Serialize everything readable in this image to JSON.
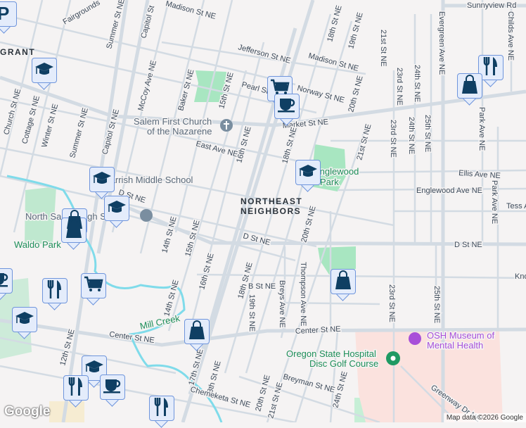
{
  "map": {
    "attribution": "Map data ©2026 Google",
    "logo": "Google",
    "colors": {
      "background": "#f5f3f3",
      "road": "#d3dbe3",
      "park": "#a8e6c1",
      "hospital": "#fbe2de",
      "creek": "#7fdbea",
      "marker_fill": "#e4ecfb",
      "marker_border": "#6f95dc",
      "icon": "#0f3f63"
    },
    "neighborhoods": [
      "GRANT",
      "NORTHEAST",
      "NEIGHBORS"
    ],
    "streets": [
      "Madison St NE",
      "Fairgrounds",
      "Summer St NE",
      "Capitol St",
      "Jefferson St NE",
      "Madison St NE",
      "18th St NE",
      "19th St NE",
      "21st St NE",
      "23rd St NE",
      "24th St NE",
      "Evergreen Ave NE",
      "Childs Ave NE",
      "Sunnyview Rd",
      "Pearl St",
      "Norway St NE",
      "20th St NE",
      "Market St NE",
      "Church St NE",
      "Cottage St NE",
      "Winter St NE",
      "Summer St NE",
      "Capitol St NE",
      "McCoy Ave NE",
      "Baker St NE",
      "15th St NE",
      "East Ave NE",
      "16th St NE",
      "18th St NE",
      "21st St NE",
      "23rd St NE",
      "24th St NE",
      "25th St NE",
      "Park Ave NE",
      "Ellis Ave NE",
      "Englewood Ave NE",
      "Park Ave NE",
      "Tess Ave",
      "D St NE",
      "14th St NE",
      "15th St NE",
      "16th St NE",
      "D St NE",
      "20th St NE",
      "D St NE",
      "Thompson Ave NE",
      "Breys Ave NE",
      "18th St NE",
      "19th St NE",
      "B St NE",
      "Knox",
      "23rd St NE",
      "25th St NE",
      "12th St NE",
      "Center St NE",
      "Center St NE",
      "17th St NE",
      "18th St NE",
      "20th St NE",
      "21st St NE",
      "Breyman St NE",
      "24th St NE",
      "Chemeketa St NE",
      "Greenway Dr NE",
      "14th St NE"
    ],
    "places": {
      "church": [
        "Salem First Church",
        "of the Nazarene"
      ],
      "school": "Parrish Middle School",
      "high_school": "North Salem High School",
      "park1": "Waldo Park",
      "park2": [
        "Englewood",
        "Park"
      ],
      "creek": "Mill Creek",
      "museum": [
        "OSH Museum of",
        "Mental Health"
      ],
      "disc_golf": [
        "Oregon State Hospital",
        "Disc Golf Course"
      ]
    },
    "markers": [
      {
        "type": "parking"
      },
      {
        "type": "school"
      },
      {
        "type": "grocery"
      },
      {
        "type": "cafe"
      },
      {
        "type": "restaurant"
      },
      {
        "type": "shopping"
      },
      {
        "type": "school"
      },
      {
        "type": "school"
      },
      {
        "type": "school"
      },
      {
        "type": "shopping"
      },
      {
        "type": "shopping"
      },
      {
        "type": "shopping"
      },
      {
        "type": "cafe"
      },
      {
        "type": "restaurant"
      },
      {
        "type": "grocery"
      },
      {
        "type": "school"
      },
      {
        "type": "shopping"
      },
      {
        "type": "school"
      },
      {
        "type": "restaurant"
      },
      {
        "type": "cafe"
      },
      {
        "type": "restaurant"
      }
    ]
  }
}
